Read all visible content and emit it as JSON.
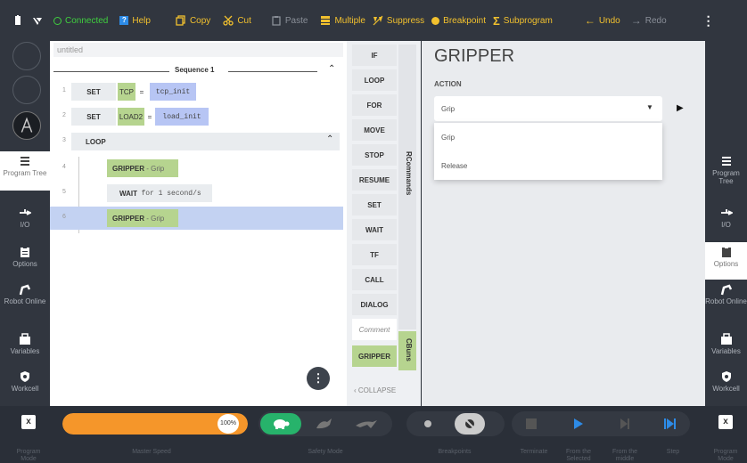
{
  "toolbar": {
    "connected": "Connected",
    "help": "Help",
    "copy": "Copy",
    "cut": "Cut",
    "paste": "Paste",
    "multiple": "Multiple",
    "suppress": "Suppress",
    "breakpoint": "Breakpoint",
    "subprogram": "Subprogram",
    "undo": "Undo",
    "redo": "Redo"
  },
  "left_nav": [
    {
      "label": "Program Tree",
      "icon": "list-icon"
    },
    {
      "label": "I/O",
      "icon": "io-icon"
    },
    {
      "label": "Options",
      "icon": "clipboard-icon"
    },
    {
      "label": "Robot Online",
      "icon": "robot-arm-icon"
    },
    {
      "label": "Variables",
      "icon": "briefcase-icon"
    },
    {
      "label": "Workcell",
      "icon": "shield-icon"
    }
  ],
  "program": {
    "title": "untitled",
    "sequence": "Sequence 1",
    "rows": [
      {
        "num": "1",
        "cmd": "SET",
        "var": "TCP",
        "eq": "=",
        "val": "tcp_init"
      },
      {
        "num": "2",
        "cmd": "SET",
        "var": "LOAD2",
        "eq": "=",
        "val": "load_init"
      },
      {
        "num": "3",
        "cmd": "LOOP"
      },
      {
        "num": "4",
        "cmd": "GRIPPER",
        "detail": "- Grip"
      },
      {
        "num": "5",
        "cmd": "WAIT",
        "detail": "for 1 second/s"
      },
      {
        "num": "6",
        "cmd": "GRIPPER",
        "detail": "- Grip"
      }
    ]
  },
  "commands": [
    "IF",
    "LOOP",
    "FOR",
    "MOVE",
    "STOP",
    "RESUME",
    "SET",
    "WAIT",
    "TF",
    "CALL",
    "DIALOG",
    "Comment",
    "GRIPPER"
  ],
  "rcommands_label": "RCommands",
  "cbuns_label": "CBuns",
  "collapse": "COLLAPSE",
  "gripper": {
    "title": "GRIPPER",
    "action_label": "ACTION",
    "selected": "Grip",
    "options": [
      "Grip",
      "Release"
    ]
  },
  "bottom": {
    "program_mode": "Program Mode",
    "master_speed": "Master Speed",
    "speed_value": "100%",
    "speed_fraction": 1.0,
    "safety_mode": "Safety Mode",
    "breakpoints": "Breakpoints",
    "terminate": "Terminate",
    "from_selected": "From the Selected",
    "from_middle": "From the middle",
    "step": "Step",
    "program_mode_right": "Program Mode"
  },
  "colors": {
    "accent_yellow": "#f2c12e",
    "connected_green": "#3fcf3f",
    "speed_orange": "#f5962a",
    "turtle_green": "#27b36b",
    "play_blue": "#2d8be6"
  }
}
